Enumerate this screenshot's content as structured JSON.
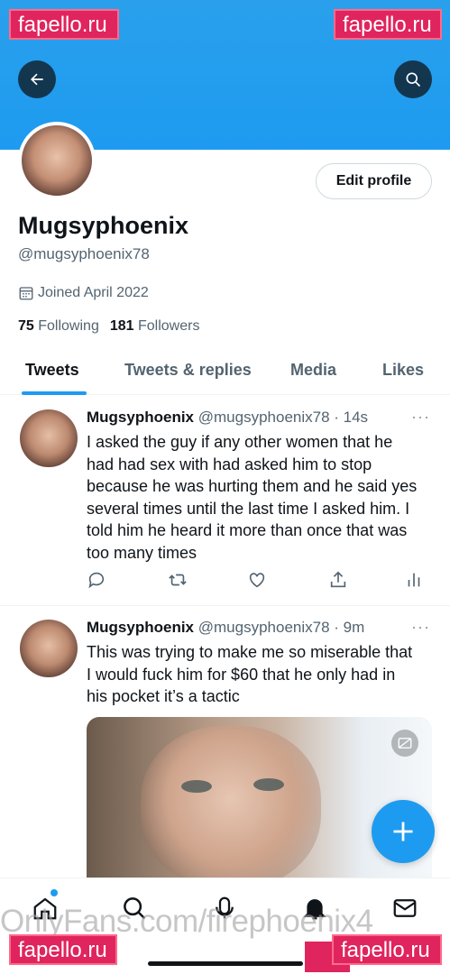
{
  "watermarks": {
    "top_left": "fapello.ru",
    "top_right": "fapello.ru",
    "bottom_left": "fapello.ru",
    "bottom_right": "fapello.ru",
    "footer_overlay": "OnlyFans.com/firephoenix4"
  },
  "header": {
    "back_icon": "arrow-left-icon",
    "search_icon": "search-icon"
  },
  "profile": {
    "display_name": "Mugsyphoenix",
    "handle": "@mugsyphoenix78",
    "edit_button": "Edit profile",
    "joined": "Joined April 2022",
    "following_count": "75",
    "following_label": "Following",
    "followers_count": "181",
    "followers_label": "Followers"
  },
  "tabs": [
    {
      "label": "Tweets",
      "active": true
    },
    {
      "label": "Tweets & replies",
      "active": false
    },
    {
      "label": "Media",
      "active": false
    },
    {
      "label": "Likes",
      "active": false
    }
  ],
  "tweets": [
    {
      "name": "Mugsyphoenix",
      "meta": "@mugsyphoenix78 · 14s",
      "text": "I asked the guy if any other women that he had had sex with had asked him to stop because he was hurting them and he said yes several times until the last time I asked him. I told him he heard it more than once that was too many times",
      "more": "···"
    },
    {
      "name": "Mugsyphoenix",
      "meta": "@mugsyphoenix78 · 9m",
      "text": "This was trying to make me so miserable that I would fuck him for $60 that he only had in his pocket it’s a tactic",
      "more": "···"
    }
  ],
  "fab_icon": "plus-icon",
  "bottom_nav": [
    "home-icon",
    "search-icon",
    "spaces-icon",
    "notifications-icon",
    "messages-icon"
  ],
  "colors": {
    "accent": "#1d9bf0",
    "text_primary": "#0f1419",
    "text_secondary": "#536471"
  }
}
